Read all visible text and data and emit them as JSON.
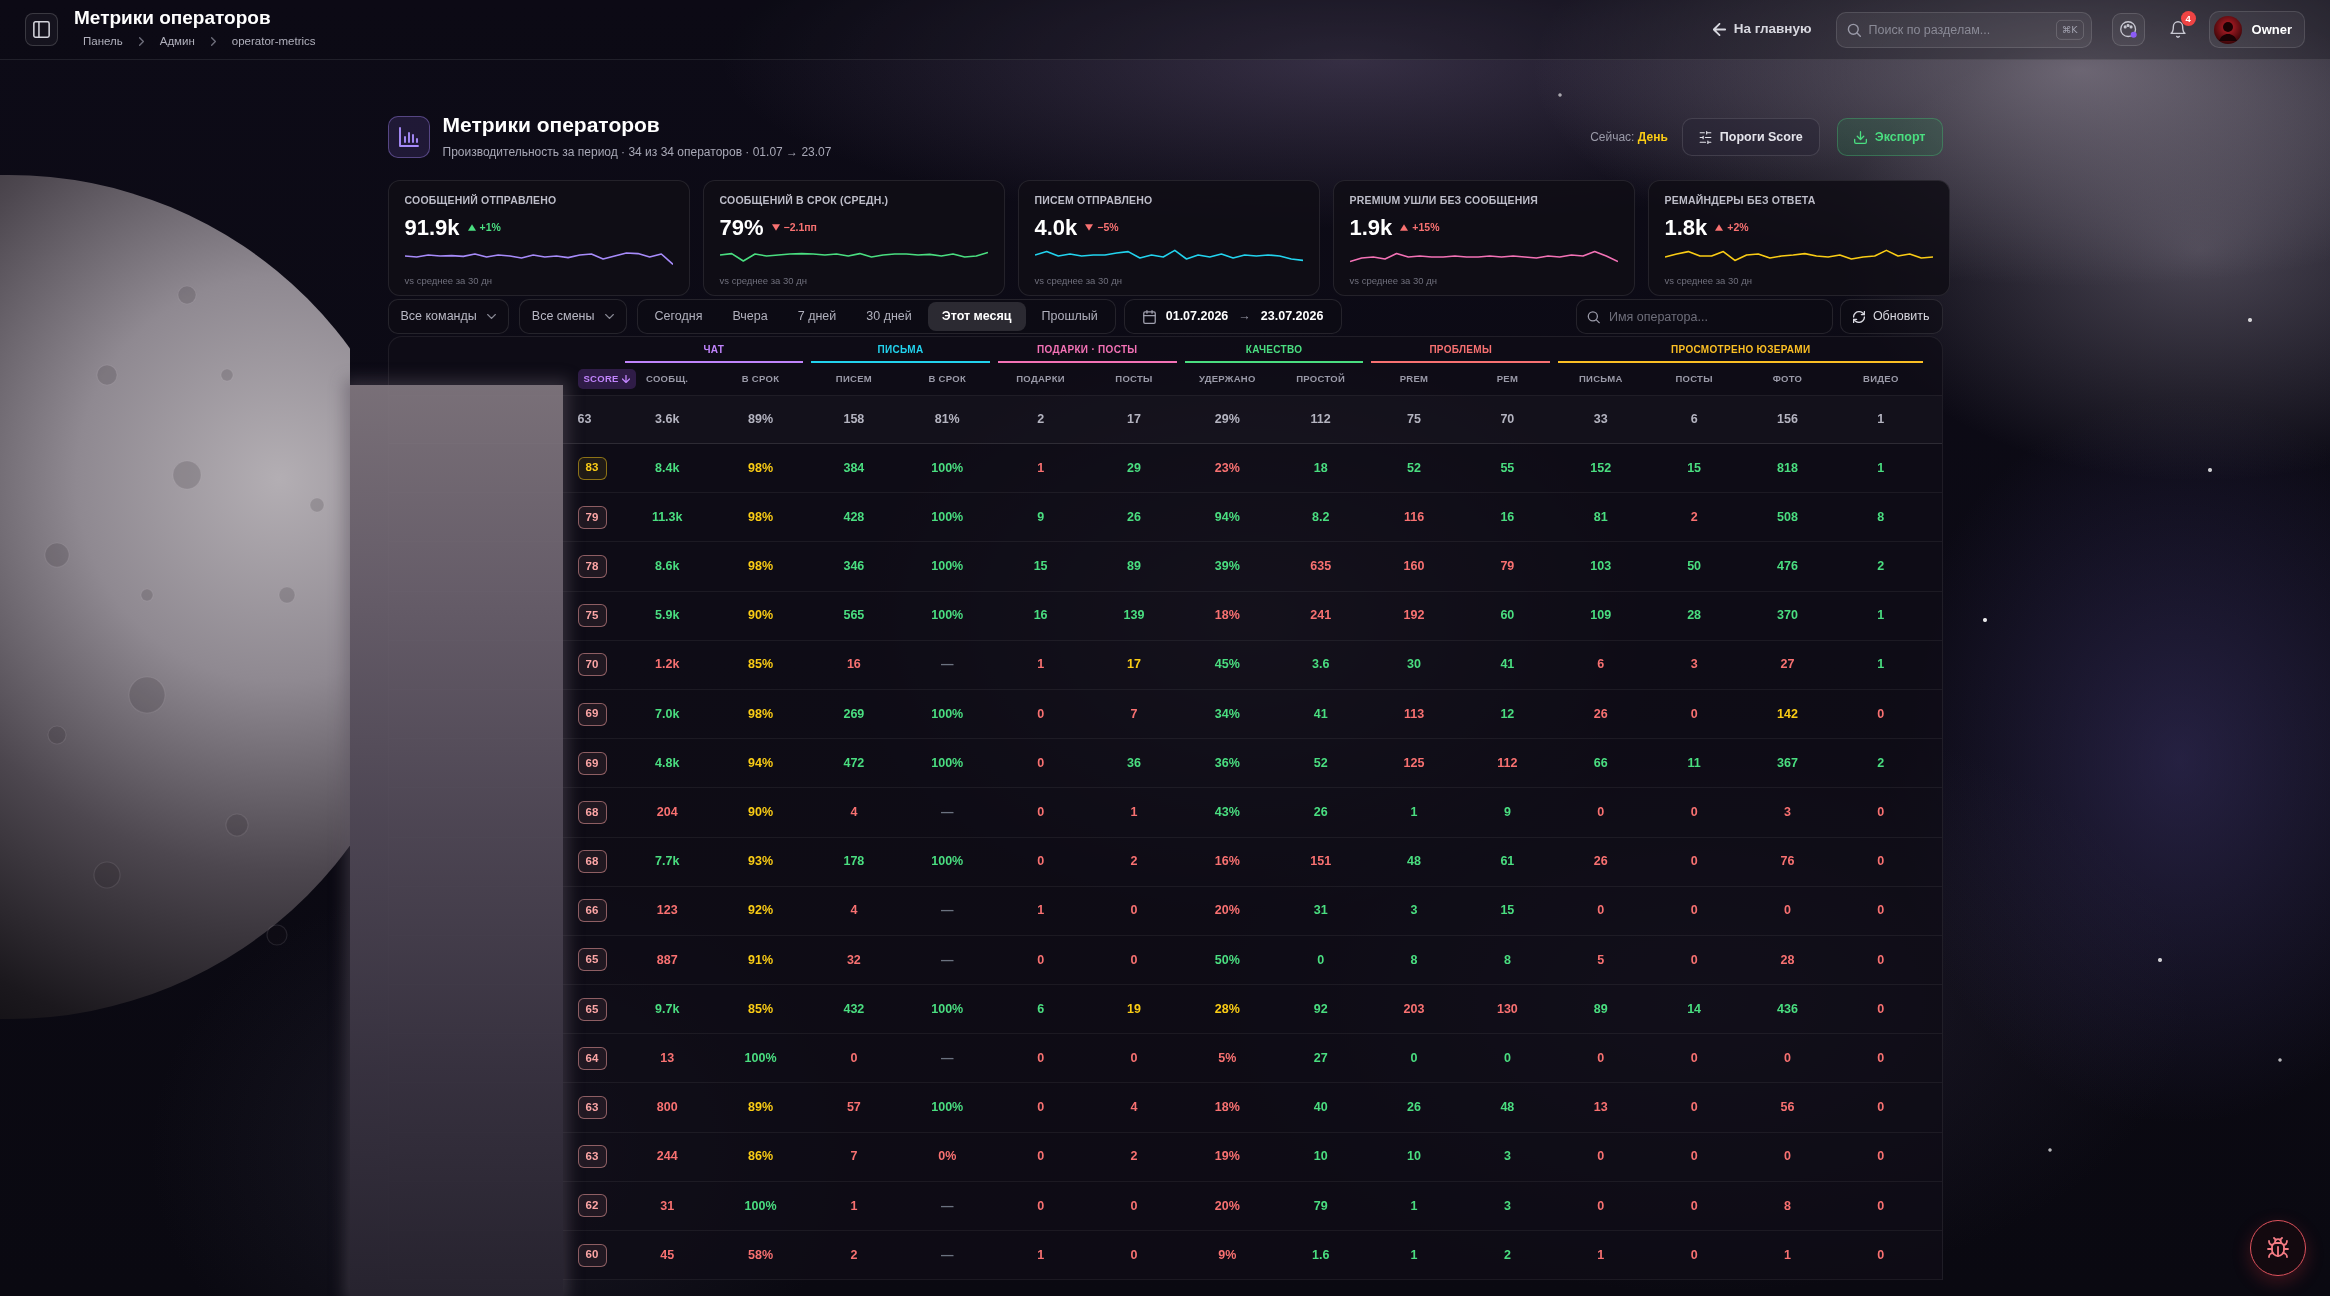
{
  "topbar": {
    "title": "Метрики операторов",
    "breadcrumbs": [
      "Панель",
      "Админ",
      "operator-metrics"
    ],
    "home_link": "На главную",
    "search": {
      "placeholder": "Поиск по разделам...",
      "shortcut": "⌘K"
    },
    "notifications": {
      "count": "4"
    },
    "user": {
      "name": "Owner"
    }
  },
  "header": {
    "title": "Метрики операторов",
    "subtitle": "Производительность за период · 34 из 34 операторов · 01.07 → 23.07",
    "mode": {
      "label": "Сейчас:",
      "value": "День"
    },
    "buttons": [
      {
        "label": "Пороги Score",
        "kind": "thresholds"
      },
      {
        "label": "Экспорт",
        "kind": "export"
      }
    ]
  },
  "kpis": [
    {
      "label": "СООБЩЕНИЙ ОТПРАВЛЕНО",
      "value": "91.9k",
      "delta": "+1%",
      "rising": true,
      "good": true,
      "color": "#a78bfa",
      "footnote": "vs среднее за 30 дн"
    },
    {
      "label": "СООБЩЕНИЙ В СРОК (СРЕДН.)",
      "value": "79%",
      "delta": "−2.1пп",
      "rising": false,
      "good": false,
      "color": "#4ade80",
      "footnote": "vs среднее за 30 дн"
    },
    {
      "label": "ПИСЕМ ОТПРАВЛЕНО",
      "value": "4.0k",
      "delta": "−5%",
      "rising": false,
      "good": false,
      "color": "#22d3ee",
      "footnote": "vs среднее за 30 дн"
    },
    {
      "label": "PREMIUM УШЛИ БЕЗ СООБЩЕНИЯ",
      "value": "1.9k",
      "delta": "+15%",
      "rising": true,
      "good": false,
      "color": "#f472b6",
      "footnote": "vs среднее за 30 дн"
    },
    {
      "label": "РЕМАЙНДЕРЫ БЕЗ ОТВЕТА",
      "value": "1.8k",
      "delta": "+2%",
      "rising": true,
      "good": false,
      "color": "#facc15",
      "footnote": "vs среднее за 30 дн"
    }
  ],
  "filters": {
    "dropdowns": [
      "Все команды",
      "Все смены"
    ],
    "periods": [
      {
        "label": "Сегодня",
        "selected": false
      },
      {
        "label": "Вчера",
        "selected": false
      },
      {
        "label": "7 дней",
        "selected": false
      },
      {
        "label": "30 дней",
        "selected": false
      },
      {
        "label": "Этот месяц",
        "selected": true
      },
      {
        "label": "Прошлый",
        "selected": false
      }
    ],
    "date_from": "01.07.2026",
    "date_separator": "→",
    "date_to": "23.07.2026",
    "search": {
      "placeholder": "Имя оператора..."
    },
    "refresh": "Обновить"
  },
  "table": {
    "score_column": {
      "label": "SCORE",
      "sorted": true
    },
    "groups": [
      {
        "label": "ЧАТ",
        "color": "#c084fc",
        "columns": [
          {
            "label": "СООБЩ.",
            "sorted": false
          },
          {
            "label": "В СРОК",
            "sorted": false
          }
        ]
      },
      {
        "label": "ПИСЬМА",
        "color": "#22d3ee",
        "columns": [
          {
            "label": "ПИСЕМ",
            "sorted": false
          },
          {
            "label": "В СРОК",
            "sorted": false
          }
        ]
      },
      {
        "label": "ПОДАРКИ · ПОСТЫ",
        "color": "#f472b6",
        "columns": [
          {
            "label": "ПОДАРКИ",
            "sorted": false
          },
          {
            "label": "ПОСТЫ",
            "sorted": false
          }
        ]
      },
      {
        "label": "КАЧЕСТВО",
        "color": "#4ade80",
        "columns": [
          {
            "label": "УДЕРЖАНО",
            "sorted": false
          },
          {
            "label": "ПРОСТОЙ",
            "sorted": false
          }
        ]
      },
      {
        "label": "ПРОБЛЕМЫ",
        "color": "#f87171",
        "columns": [
          {
            "label": "PREM",
            "sorted": false
          },
          {
            "label": "РЕМ",
            "sorted": false
          }
        ]
      },
      {
        "label": "ПРОСМОТРЕНО ЮЗЕРАМИ",
        "color": "#fbbf24",
        "columns": [
          {
            "label": "ПИСЬМА",
            "sorted": false
          },
          {
            "label": "ПОСТЫ",
            "sorted": false
          },
          {
            "label": "ФОТО",
            "sorted": false
          },
          {
            "label": "ВИДЕО",
            "sorted": false
          }
        ]
      }
    ],
    "summary_row": {
      "score": "63",
      "cells": [
        "3.6k",
        "89%",
        "158",
        "81%",
        "2",
        "17",
        "29%",
        "112",
        "75",
        "70",
        "33",
        "6",
        "156",
        "1"
      ]
    },
    "rows": [
      {
        "score": {
          "text": "83",
          "color": "#facc15"
        },
        "cells": [
          {
            "text": "8.4k",
            "color": "#4ade80"
          },
          {
            "text": "98%",
            "color": "#facc15"
          },
          {
            "text": "384",
            "color": "#4ade80"
          },
          {
            "text": "100%",
            "color": "#4ade80"
          },
          {
            "text": "1",
            "color": "#f87171"
          },
          {
            "text": "29",
            "color": "#4ade80"
          },
          {
            "text": "23%",
            "color": "#f87171"
          },
          {
            "text": "18",
            "color": "#4ade80"
          },
          {
            "text": "52",
            "color": "#4ade80"
          },
          {
            "text": "55",
            "color": "#4ade80"
          },
          {
            "text": "152",
            "color": "#4ade80"
          },
          {
            "text": "15",
            "color": "#4ade80"
          },
          {
            "text": "818",
            "color": "#4ade80"
          },
          {
            "text": "1",
            "color": "#4ade80"
          }
        ]
      },
      {
        "score": {
          "text": "79",
          "color": "#fca5a5"
        },
        "cells": [
          {
            "text": "11.3k",
            "color": "#4ade80"
          },
          {
            "text": "98%",
            "color": "#facc15"
          },
          {
            "text": "428",
            "color": "#4ade80"
          },
          {
            "text": "100%",
            "color": "#4ade80"
          },
          {
            "text": "9",
            "color": "#4ade80"
          },
          {
            "text": "26",
            "color": "#4ade80"
          },
          {
            "text": "94%",
            "color": "#4ade80"
          },
          {
            "text": "8.2",
            "color": "#4ade80"
          },
          {
            "text": "116",
            "color": "#f87171"
          },
          {
            "text": "16",
            "color": "#4ade80"
          },
          {
            "text": "81",
            "color": "#4ade80"
          },
          {
            "text": "2",
            "color": "#f87171"
          },
          {
            "text": "508",
            "color": "#4ade80"
          },
          {
            "text": "8",
            "color": "#4ade80"
          }
        ]
      },
      {
        "score": {
          "text": "78",
          "color": "#fca5a5"
        },
        "cells": [
          {
            "text": "8.6k",
            "color": "#4ade80"
          },
          {
            "text": "98%",
            "color": "#facc15"
          },
          {
            "text": "346",
            "color": "#4ade80"
          },
          {
            "text": "100%",
            "color": "#4ade80"
          },
          {
            "text": "15",
            "color": "#4ade80"
          },
          {
            "text": "89",
            "color": "#4ade80"
          },
          {
            "text": "39%",
            "color": "#4ade80"
          },
          {
            "text": "635",
            "color": "#f87171"
          },
          {
            "text": "160",
            "color": "#f87171"
          },
          {
            "text": "79",
            "color": "#f87171"
          },
          {
            "text": "103",
            "color": "#4ade80"
          },
          {
            "text": "50",
            "color": "#4ade80"
          },
          {
            "text": "476",
            "color": "#4ade80"
          },
          {
            "text": "2",
            "color": "#4ade80"
          }
        ]
      },
      {
        "score": {
          "text": "75",
          "color": "#fca5a5"
        },
        "cells": [
          {
            "text": "5.9k",
            "color": "#4ade80"
          },
          {
            "text": "90%",
            "color": "#facc15"
          },
          {
            "text": "565",
            "color": "#4ade80"
          },
          {
            "text": "100%",
            "color": "#4ade80"
          },
          {
            "text": "16",
            "color": "#4ade80"
          },
          {
            "text": "139",
            "color": "#4ade80"
          },
          {
            "text": "18%",
            "color": "#f87171"
          },
          {
            "text": "241",
            "color": "#f87171"
          },
          {
            "text": "192",
            "color": "#f87171"
          },
          {
            "text": "60",
            "color": "#4ade80"
          },
          {
            "text": "109",
            "color": "#4ade80"
          },
          {
            "text": "28",
            "color": "#4ade80"
          },
          {
            "text": "370",
            "color": "#4ade80"
          },
          {
            "text": "1",
            "color": "#4ade80"
          }
        ]
      },
      {
        "score": {
          "text": "70",
          "color": "#fca5a5"
        },
        "cells": [
          {
            "text": "1.2k",
            "color": "#f87171"
          },
          {
            "text": "85%",
            "color": "#facc15"
          },
          {
            "text": "16",
            "color": "#f87171"
          },
          {
            "text": "—",
            "color": "#6b7280"
          },
          {
            "text": "1",
            "color": "#f87171"
          },
          {
            "text": "17",
            "color": "#facc15"
          },
          {
            "text": "45%",
            "color": "#4ade80"
          },
          {
            "text": "3.6",
            "color": "#4ade80"
          },
          {
            "text": "30",
            "color": "#4ade80"
          },
          {
            "text": "41",
            "color": "#4ade80"
          },
          {
            "text": "6",
            "color": "#f87171"
          },
          {
            "text": "3",
            "color": "#f87171"
          },
          {
            "text": "27",
            "color": "#f87171"
          },
          {
            "text": "1",
            "color": "#4ade80"
          }
        ]
      },
      {
        "score": {
          "text": "69",
          "color": "#fca5a5"
        },
        "cells": [
          {
            "text": "7.0k",
            "color": "#4ade80"
          },
          {
            "text": "98%",
            "color": "#facc15"
          },
          {
            "text": "269",
            "color": "#4ade80"
          },
          {
            "text": "100%",
            "color": "#4ade80"
          },
          {
            "text": "0",
            "color": "#f87171"
          },
          {
            "text": "7",
            "color": "#f87171"
          },
          {
            "text": "34%",
            "color": "#4ade80"
          },
          {
            "text": "41",
            "color": "#4ade80"
          },
          {
            "text": "113",
            "color": "#f87171"
          },
          {
            "text": "12",
            "color": "#4ade80"
          },
          {
            "text": "26",
            "color": "#f87171"
          },
          {
            "text": "0",
            "color": "#f87171"
          },
          {
            "text": "142",
            "color": "#facc15"
          },
          {
            "text": "0",
            "color": "#f87171"
          }
        ]
      },
      {
        "score": {
          "text": "69",
          "color": "#fca5a5"
        },
        "cells": [
          {
            "text": "4.8k",
            "color": "#4ade80"
          },
          {
            "text": "94%",
            "color": "#facc15"
          },
          {
            "text": "472",
            "color": "#4ade80"
          },
          {
            "text": "100%",
            "color": "#4ade80"
          },
          {
            "text": "0",
            "color": "#f87171"
          },
          {
            "text": "36",
            "color": "#4ade80"
          },
          {
            "text": "36%",
            "color": "#4ade80"
          },
          {
            "text": "52",
            "color": "#4ade80"
          },
          {
            "text": "125",
            "color": "#f87171"
          },
          {
            "text": "112",
            "color": "#f87171"
          },
          {
            "text": "66",
            "color": "#4ade80"
          },
          {
            "text": "11",
            "color": "#4ade80"
          },
          {
            "text": "367",
            "color": "#4ade80"
          },
          {
            "text": "2",
            "color": "#4ade80"
          }
        ]
      },
      {
        "score": {
          "text": "68",
          "color": "#fca5a5"
        },
        "cells": [
          {
            "text": "204",
            "color": "#f87171"
          },
          {
            "text": "90%",
            "color": "#facc15"
          },
          {
            "text": "4",
            "color": "#f87171"
          },
          {
            "text": "—",
            "color": "#6b7280"
          },
          {
            "text": "0",
            "color": "#f87171"
          },
          {
            "text": "1",
            "color": "#f87171"
          },
          {
            "text": "43%",
            "color": "#4ade80"
          },
          {
            "text": "26",
            "color": "#4ade80"
          },
          {
            "text": "1",
            "color": "#4ade80"
          },
          {
            "text": "9",
            "color": "#4ade80"
          },
          {
            "text": "0",
            "color": "#f87171"
          },
          {
            "text": "0",
            "color": "#f87171"
          },
          {
            "text": "3",
            "color": "#f87171"
          },
          {
            "text": "0",
            "color": "#f87171"
          }
        ]
      },
      {
        "score": {
          "text": "68",
          "color": "#fca5a5"
        },
        "cells": [
          {
            "text": "7.7k",
            "color": "#4ade80"
          },
          {
            "text": "93%",
            "color": "#facc15"
          },
          {
            "text": "178",
            "color": "#4ade80"
          },
          {
            "text": "100%",
            "color": "#4ade80"
          },
          {
            "text": "0",
            "color": "#f87171"
          },
          {
            "text": "2",
            "color": "#f87171"
          },
          {
            "text": "16%",
            "color": "#f87171"
          },
          {
            "text": "151",
            "color": "#f87171"
          },
          {
            "text": "48",
            "color": "#4ade80"
          },
          {
            "text": "61",
            "color": "#4ade80"
          },
          {
            "text": "26",
            "color": "#f87171"
          },
          {
            "text": "0",
            "color": "#f87171"
          },
          {
            "text": "76",
            "color": "#f87171"
          },
          {
            "text": "0",
            "color": "#f87171"
          }
        ]
      },
      {
        "score": {
          "text": "66",
          "color": "#fca5a5"
        },
        "cells": [
          {
            "text": "123",
            "color": "#f87171"
          },
          {
            "text": "92%",
            "color": "#facc15"
          },
          {
            "text": "4",
            "color": "#f87171"
          },
          {
            "text": "—",
            "color": "#6b7280"
          },
          {
            "text": "1",
            "color": "#f87171"
          },
          {
            "text": "0",
            "color": "#f87171"
          },
          {
            "text": "20%",
            "color": "#f87171"
          },
          {
            "text": "31",
            "color": "#4ade80"
          },
          {
            "text": "3",
            "color": "#4ade80"
          },
          {
            "text": "15",
            "color": "#4ade80"
          },
          {
            "text": "0",
            "color": "#f87171"
          },
          {
            "text": "0",
            "color": "#f87171"
          },
          {
            "text": "0",
            "color": "#f87171"
          },
          {
            "text": "0",
            "color": "#f87171"
          }
        ]
      },
      {
        "score": {
          "text": "65",
          "color": "#fca5a5"
        },
        "cells": [
          {
            "text": "887",
            "color": "#f87171"
          },
          {
            "text": "91%",
            "color": "#facc15"
          },
          {
            "text": "32",
            "color": "#f87171"
          },
          {
            "text": "—",
            "color": "#6b7280"
          },
          {
            "text": "0",
            "color": "#f87171"
          },
          {
            "text": "0",
            "color": "#f87171"
          },
          {
            "text": "50%",
            "color": "#4ade80"
          },
          {
            "text": "0",
            "color": "#4ade80"
          },
          {
            "text": "8",
            "color": "#4ade80"
          },
          {
            "text": "8",
            "color": "#4ade80"
          },
          {
            "text": "5",
            "color": "#f87171"
          },
          {
            "text": "0",
            "color": "#f87171"
          },
          {
            "text": "28",
            "color": "#f87171"
          },
          {
            "text": "0",
            "color": "#f87171"
          }
        ]
      },
      {
        "score": {
          "text": "65",
          "color": "#fca5a5"
        },
        "cells": [
          {
            "text": "9.7k",
            "color": "#4ade80"
          },
          {
            "text": "85%",
            "color": "#facc15"
          },
          {
            "text": "432",
            "color": "#4ade80"
          },
          {
            "text": "100%",
            "color": "#4ade80"
          },
          {
            "text": "6",
            "color": "#4ade80"
          },
          {
            "text": "19",
            "color": "#facc15"
          },
          {
            "text": "28%",
            "color": "#facc15"
          },
          {
            "text": "92",
            "color": "#4ade80"
          },
          {
            "text": "203",
            "color": "#f87171"
          },
          {
            "text": "130",
            "color": "#f87171"
          },
          {
            "text": "89",
            "color": "#4ade80"
          },
          {
            "text": "14",
            "color": "#4ade80"
          },
          {
            "text": "436",
            "color": "#4ade80"
          },
          {
            "text": "0",
            "color": "#f87171"
          }
        ]
      },
      {
        "score": {
          "text": "64",
          "color": "#fca5a5"
        },
        "cells": [
          {
            "text": "13",
            "color": "#f87171"
          },
          {
            "text": "100%",
            "color": "#4ade80"
          },
          {
            "text": "0",
            "color": "#f87171"
          },
          {
            "text": "—",
            "color": "#6b7280"
          },
          {
            "text": "0",
            "color": "#f87171"
          },
          {
            "text": "0",
            "color": "#f87171"
          },
          {
            "text": "5%",
            "color": "#f87171"
          },
          {
            "text": "27",
            "color": "#4ade80"
          },
          {
            "text": "0",
            "color": "#4ade80"
          },
          {
            "text": "0",
            "color": "#4ade80"
          },
          {
            "text": "0",
            "color": "#f87171"
          },
          {
            "text": "0",
            "color": "#f87171"
          },
          {
            "text": "0",
            "color": "#f87171"
          },
          {
            "text": "0",
            "color": "#f87171"
          }
        ]
      },
      {
        "score": {
          "text": "63",
          "color": "#fca5a5"
        },
        "cells": [
          {
            "text": "800",
            "color": "#f87171"
          },
          {
            "text": "89%",
            "color": "#facc15"
          },
          {
            "text": "57",
            "color": "#f87171"
          },
          {
            "text": "100%",
            "color": "#4ade80"
          },
          {
            "text": "0",
            "color": "#f87171"
          },
          {
            "text": "4",
            "color": "#f87171"
          },
          {
            "text": "18%",
            "color": "#f87171"
          },
          {
            "text": "40",
            "color": "#4ade80"
          },
          {
            "text": "26",
            "color": "#4ade80"
          },
          {
            "text": "48",
            "color": "#4ade80"
          },
          {
            "text": "13",
            "color": "#f87171"
          },
          {
            "text": "0",
            "color": "#f87171"
          },
          {
            "text": "56",
            "color": "#f87171"
          },
          {
            "text": "0",
            "color": "#f87171"
          }
        ]
      },
      {
        "score": {
          "text": "63",
          "color": "#fca5a5"
        },
        "cells": [
          {
            "text": "244",
            "color": "#f87171"
          },
          {
            "text": "86%",
            "color": "#facc15"
          },
          {
            "text": "7",
            "color": "#f87171"
          },
          {
            "text": "0%",
            "color": "#f87171"
          },
          {
            "text": "0",
            "color": "#f87171"
          },
          {
            "text": "2",
            "color": "#f87171"
          },
          {
            "text": "19%",
            "color": "#f87171"
          },
          {
            "text": "10",
            "color": "#4ade80"
          },
          {
            "text": "10",
            "color": "#4ade80"
          },
          {
            "text": "3",
            "color": "#4ade80"
          },
          {
            "text": "0",
            "color": "#f87171"
          },
          {
            "text": "0",
            "color": "#f87171"
          },
          {
            "text": "0",
            "color": "#f87171"
          },
          {
            "text": "0",
            "color": "#f87171"
          }
        ]
      },
      {
        "score": {
          "text": "62",
          "color": "#fca5a5"
        },
        "cells": [
          {
            "text": "31",
            "color": "#f87171"
          },
          {
            "text": "100%",
            "color": "#4ade80"
          },
          {
            "text": "1",
            "color": "#f87171"
          },
          {
            "text": "—",
            "color": "#6b7280"
          },
          {
            "text": "0",
            "color": "#f87171"
          },
          {
            "text": "0",
            "color": "#f87171"
          },
          {
            "text": "20%",
            "color": "#f87171"
          },
          {
            "text": "79",
            "color": "#4ade80"
          },
          {
            "text": "1",
            "color": "#4ade80"
          },
          {
            "text": "3",
            "color": "#4ade80"
          },
          {
            "text": "0",
            "color": "#f87171"
          },
          {
            "text": "0",
            "color": "#f87171"
          },
          {
            "text": "8",
            "color": "#f87171"
          },
          {
            "text": "0",
            "color": "#f87171"
          }
        ]
      },
      {
        "score": {
          "text": "60",
          "color": "#fca5a5"
        },
        "cells": [
          {
            "text": "45",
            "color": "#f87171"
          },
          {
            "text": "58%",
            "color": "#f87171"
          },
          {
            "text": "2",
            "color": "#f87171"
          },
          {
            "text": "—",
            "color": "#6b7280"
          },
          {
            "text": "1",
            "color": "#f87171"
          },
          {
            "text": "0",
            "color": "#f87171"
          },
          {
            "text": "9%",
            "color": "#f87171"
          },
          {
            "text": "1.6",
            "color": "#4ade80"
          },
          {
            "text": "1",
            "color": "#4ade80"
          },
          {
            "text": "2",
            "color": "#4ade80"
          },
          {
            "text": "1",
            "color": "#f87171"
          },
          {
            "text": "0",
            "color": "#f87171"
          },
          {
            "text": "1",
            "color": "#f87171"
          },
          {
            "text": "0",
            "color": "#f87171"
          }
        ]
      }
    ]
  }
}
